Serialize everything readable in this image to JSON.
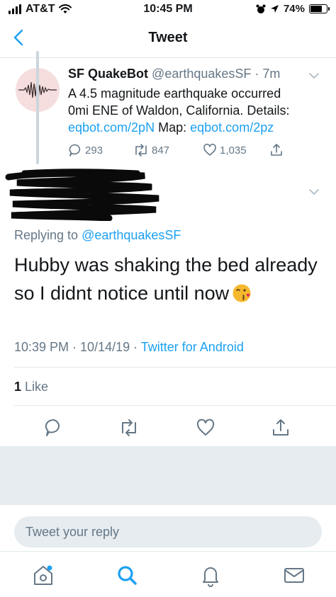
{
  "status_bar": {
    "carrier": "AT&T",
    "time": "10:45 PM",
    "battery": "74%",
    "battery_level": 0.74
  },
  "nav": {
    "title": "Tweet",
    "back_icon": "chevron-left-icon"
  },
  "parent_tweet": {
    "name": "SF QuakeBot",
    "handle": "@earthquakesSF",
    "time": "7m",
    "text_line1": "A 4.5 magnitude earthquake occurred",
    "text_line2": "0mi ENE of Waldon, California. Details:",
    "link1": "eqbot.com/2pN",
    "map_label": "Map:",
    "link2": "eqbot.com/2pz",
    "replies": "293",
    "retweets": "847",
    "likes": "1,035"
  },
  "main_tweet": {
    "replying_prefix": "Replying to",
    "replying_handle": "@earthquakesSF",
    "text_line1": "Hubby was shaking the bed already",
    "text_line2": "so I didnt notice until now",
    "emoji": "face-blowing-kiss-emoji",
    "timestamp": "10:39 PM · 10/14/19 · ",
    "client": "Twitter for Android",
    "like_count": "1",
    "like_label": "Like"
  },
  "reply": {
    "placeholder": "Tweet your reply"
  },
  "colors": {
    "accent": "#1da1f2",
    "secondary_text": "#657786",
    "divider": "#e1e8ed",
    "background_gray": "#e6ecf0"
  },
  "tab_bar": {
    "items": [
      "home-icon",
      "search-icon",
      "notifications-icon",
      "messages-icon"
    ]
  }
}
